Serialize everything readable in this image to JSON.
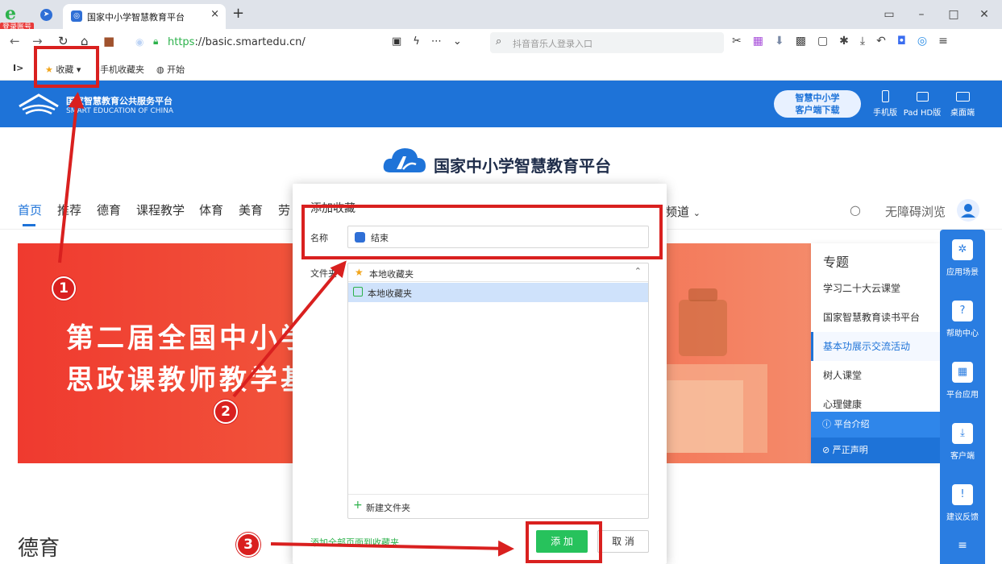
{
  "browser": {
    "login_badge": "登录账号",
    "tab_title": "国家中小学智慧教育平台",
    "tab_close": "×",
    "new_tab": "+",
    "url_scheme": "https",
    "url_rest": "://basic.smartedu.cn/",
    "search_placeholder": "抖音音乐人登录入口",
    "window_controls": [
      "▭",
      "–",
      "□",
      "✕"
    ]
  },
  "bookmarks": {
    "toggle": "I>",
    "favorites_label": "收藏",
    "favorites_arrow": "▾",
    "mobile_favorites": "手机收藏夹",
    "start": "开始"
  },
  "site_header": {
    "name_cn": "国家智慧教育公共服务平台",
    "name_en": "SMART EDUCATION OF CHINA",
    "download_line1": "智慧中小学",
    "download_line2": "客户端下载",
    "devices": [
      "手机版",
      "Pad HD版",
      "桌面端"
    ]
  },
  "brand_title": "国家中小学智慧教育平台",
  "main_nav": {
    "items": [
      "首页",
      "推荐",
      "德育",
      "课程教学",
      "体育",
      "美育",
      "劳"
    ],
    "more_label": "频道",
    "a11y": "无障碍浏览"
  },
  "banner": {
    "line1": "第二届全国中小学",
    "line2": "思政课教师教学基"
  },
  "topics": {
    "title": "专题",
    "items": [
      "学习二十大云课堂",
      "国家智慧教育读书平台",
      "基本功展示交流活动",
      "树人课堂",
      "心理健康"
    ],
    "actions": [
      "ⓘ 平台介绍",
      "⊘ 严正声明"
    ]
  },
  "section_title": "德育",
  "float_bar": [
    "应用场景",
    "帮助中心",
    "平台应用",
    "客户端",
    "建议反馈"
  ],
  "dialog": {
    "title": "添加收藏",
    "name_label": "名称",
    "name_value": "结束",
    "folder_label": "文件夹",
    "folder_header": "本地收藏夹",
    "folder_selected": "本地收藏夹",
    "new_folder": "新建文件夹",
    "add_all_link": "添加全部页面到收藏夹",
    "add_button": "添 加",
    "cancel_button": "取 消"
  },
  "annotations": {
    "steps": [
      "1",
      "2",
      "3"
    ],
    "color": "#d9201f"
  },
  "colors": {
    "brand_blue": "#1e73d8",
    "green": "#27c25c",
    "banner_red": "#ef3a2f"
  }
}
